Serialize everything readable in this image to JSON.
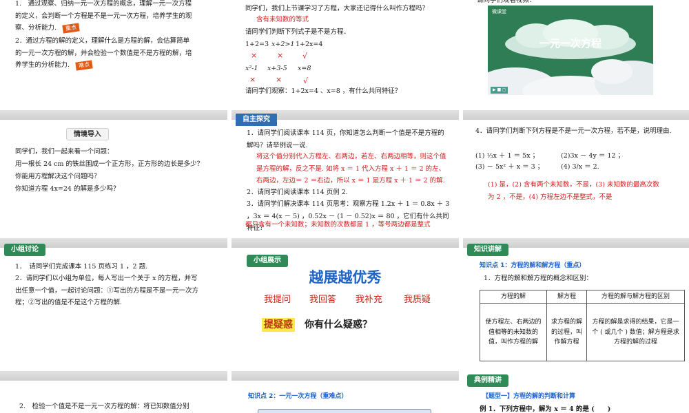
{
  "s1": {
    "obj1": "1.　通过观察、归纳一元一次方程的概念，理解一元一次方程的定义，会判断一个方程是不是一元一次方程，培养学生的观察、分析能力.",
    "badge1": "重点",
    "obj2": "2．通过方程的解的定义，理解什么是方程的解，会估算简单的一元一次方程的解，并会检验一个数值是不是方程的解，培养学生的分析能力.",
    "badge2": "难点"
  },
  "s2": {
    "intro": "同学们，我们上节课学习了方程，大家还记得什么叫作方程吗？",
    "answer": "含有未知数的等式",
    "prompt": "请同学们判断下列式子是不是方程．",
    "row1": [
      "1+2=3",
      "x+2>1",
      "1+2x=4"
    ],
    "row1_marks": [
      "×",
      "×",
      "√"
    ],
    "row2": [
      "x²-1",
      "x+3-5",
      "x=8"
    ],
    "row2_marks": [
      "×",
      "×",
      "√"
    ],
    "observe": "请同学们观察：1+2x=4 、x=8 ，有什么共同特征？"
  },
  "s3": {
    "prompt": "请同学们观看视频：",
    "video_title": "一元一次方程",
    "video_logo": "微课堂",
    "video_controls": "▶ ■ ◻"
  },
  "s4": {
    "tag": "情境导入",
    "lines": [
      "同学们，我们一起来看一个问题：",
      "用一根长 24 cm 的铁丝围成一个正方形，正方形的边长是多少？",
      "你能用方程解决这个问题吗？",
      "你知道方程 4x=24 的解是多少吗？"
    ]
  },
  "s5": {
    "tag": "自主探究",
    "q1": "1．请同学们阅读课本 114 页，你知道怎么判断一个值是不是方程的解吗？请举例说一说.",
    "a1": "将这个值分别代入方程左、右两边，若左、右两边相等，则这个值是方程的解，反之不是. 如将 x ＝ 1 代入方程 x ＋ 1 ＝ 2 的左、右两边，左边＝ 2 ＝右边，所以 x ＝ 1 是方程 x ＋ 1 ＝ 2 的解.",
    "q2": "2．请同学们阅读课本 114 页例 2.",
    "q3": "3．请同学们解决课本 114 页思考：观察方程 1.2x ＋ 1 ＝ 0.8x ＋ 3 ，3x ＝ 4(x － 5) ，0.52x － (1 － 0.52)x ＝ 80 ，它们有什么共同特征？",
    "a3": "都只含有一个未知数；未知数的次数都是 1 ，等号两边都是整式"
  },
  "s6": {
    "q": "4．请同学们判断下列方程是不是一元一次方程，若不是，说明理由.",
    "items": [
      "(1) ⅓x ＋ 1 ＝ 5x ；",
      "(2)3x － 4y ＝ 12 ；",
      "(3) － 5x² ＋ x ＝ 3 ；",
      "(4) 3/x ＝ 2."
    ],
    "answer": "(1) 是，(2) 含有两个未知数，不是，(3) 未知数的最高次数为 2 ，不是，(4) 方程左边不是整式，不是"
  },
  "s7": {
    "tag": "小组讨论",
    "l1": "1．　请同学们完成课本 115 页练习 1 ，2 题.",
    "l2": "2．请同学们以小组为单位，每人写出一个关于 x 的方程，并写出任意一个值，一起讨论问题：①写出的方程是不是一元一次方程；②写出的值是不是这个方程的解."
  },
  "s8": {
    "tag": "小组展示",
    "title": "越展越优秀",
    "actions": [
      "我提问",
      "我回答",
      "我补充",
      "我质疑"
    ],
    "doubt_label": "提疑惑",
    "doubt_text": "你有什么疑惑？"
  },
  "s9": {
    "tag": "知识讲解",
    "kp": "知识点 1：方程的解和解方程（重点）",
    "sub": "1．方程的解和解方程的概念和区别：",
    "headers": [
      "方程的解",
      "解方程",
      "方程的解与解方程的区别"
    ],
    "cells": [
      "使方程左、右两边的值相等的未知数的值，叫作方程的解",
      "求方程的解的过程，叫作解方程",
      "方程的解是求得的结果，它是一个 ( 或几个 ) 数值；解方程是求方程的解的过程"
    ]
  },
  "s10": {
    "text": "2.　检验一个值是不是一元一次方程的解：将已知数值分别"
  },
  "s11": {
    "kp": "知识点 2：一元一次方程（重难点）"
  },
  "s12": {
    "tag": "典例精讲",
    "type_label": "【题型一】方程的解的判断和计算",
    "example": "例 1．下列方程中，解为 x ＝ 4 的是 (　　)"
  },
  "colors": {
    "tag_blue": "#2f6db5",
    "tag_green": "#2e8b57",
    "answer_red": "#d21b1b",
    "title_blue": "#1e64c8"
  }
}
